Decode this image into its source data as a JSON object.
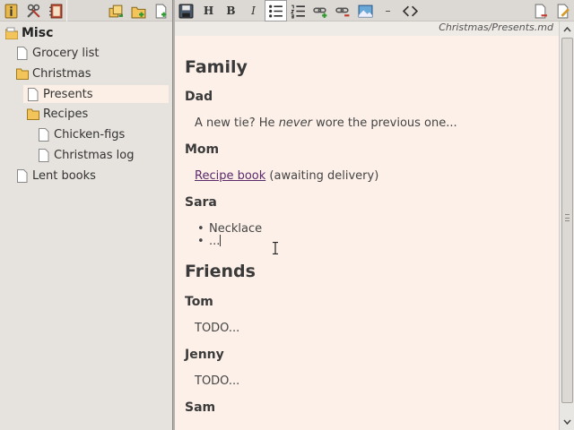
{
  "toolbar_left": {
    "buttons": [
      "info-icon",
      "tools-icon",
      "notebook-icon",
      "copy-icon",
      "new-folder-icon",
      "new-page-icon"
    ]
  },
  "toolbar_right": {
    "buttons": [
      "save-icon",
      "heading",
      "bold",
      "italic",
      "bullet-list-icon",
      "numbered-list-icon",
      "insert-link-icon",
      "remove-link-icon",
      "image-icon",
      "horizontal-rule",
      "code-icon",
      "delete-page-icon",
      "edit-page-icon"
    ],
    "heading_label": "H",
    "bold_label": "B",
    "italic_label": "I",
    "hr_label": "–"
  },
  "path": "Christmas/Presents.md",
  "tree": [
    {
      "label": "Misc",
      "kind": "root"
    },
    {
      "label": "Grocery list",
      "kind": "page"
    },
    {
      "label": "Christmas",
      "kind": "folder"
    },
    {
      "label": "Presents",
      "kind": "page",
      "selected": true
    },
    {
      "label": "Recipes",
      "kind": "folder"
    },
    {
      "label": "Chicken-figs",
      "kind": "page"
    },
    {
      "label": "Christmas log",
      "kind": "page"
    },
    {
      "label": "Lent books",
      "kind": "page"
    }
  ],
  "document": {
    "family_heading": "Family",
    "dad_heading": "Dad",
    "dad_text_before": "A new tie? He ",
    "dad_text_em": "never",
    "dad_text_after": " wore the previous one...",
    "mom_heading": "Mom",
    "mom_link": "Recipe book",
    "mom_text": " (awaiting delivery)",
    "sara_heading": "Sara",
    "sara_bullets": [
      "Necklace",
      "..."
    ],
    "friends_heading": "Friends",
    "tom_heading": "Tom",
    "tom_text": "TODO...",
    "jenny_heading": "Jenny",
    "jenny_text": "TODO...",
    "sam_heading": "Sam"
  },
  "colors": {
    "editor_bg": "#fdf0e8",
    "sidebar_bg": "#e6e2dd",
    "selection_bg": "#fbefe6",
    "link": "#5a2a6b",
    "folder": "#f2c45a"
  }
}
